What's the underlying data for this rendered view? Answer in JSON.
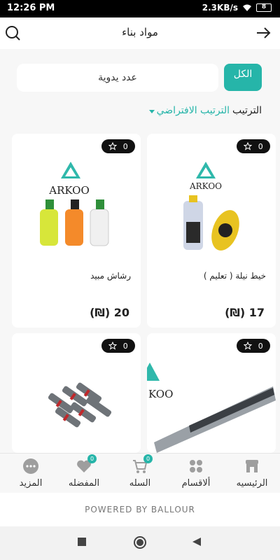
{
  "status": {
    "time": "12:26 PM",
    "speed": "2.3KB/s",
    "battery": "8"
  },
  "header": {
    "title": "مواد بناء",
    "search_icon": "search-icon",
    "back_icon": "arrow-right-icon"
  },
  "search": {
    "value": "عدد يدوية",
    "filter_button": "الكل"
  },
  "sort": {
    "label": "الترتيب",
    "value": "الترتيب الافتراضي"
  },
  "products": [
    {
      "name": "خيط نيلة ( تعليم )",
      "price": "17 (₪)",
      "favorites": "0"
    },
    {
      "name": "رشاش مبيد",
      "price": "20 (₪)",
      "favorites": "0"
    },
    {
      "name": "",
      "price": "",
      "favorites": "0"
    },
    {
      "name": "",
      "price": "",
      "favorites": "0"
    }
  ],
  "bottom_nav": {
    "home": "الرئيسيه",
    "categories": "ألاقسام",
    "cart": "السله",
    "cart_count": "0",
    "favorites": "المفضله",
    "favorites_count": "0",
    "more": "المزيد"
  },
  "footer": {
    "powered": "POWERED BY BALLOUR"
  },
  "colors": {
    "accent": "#26b5a9",
    "badge": "#111111"
  }
}
